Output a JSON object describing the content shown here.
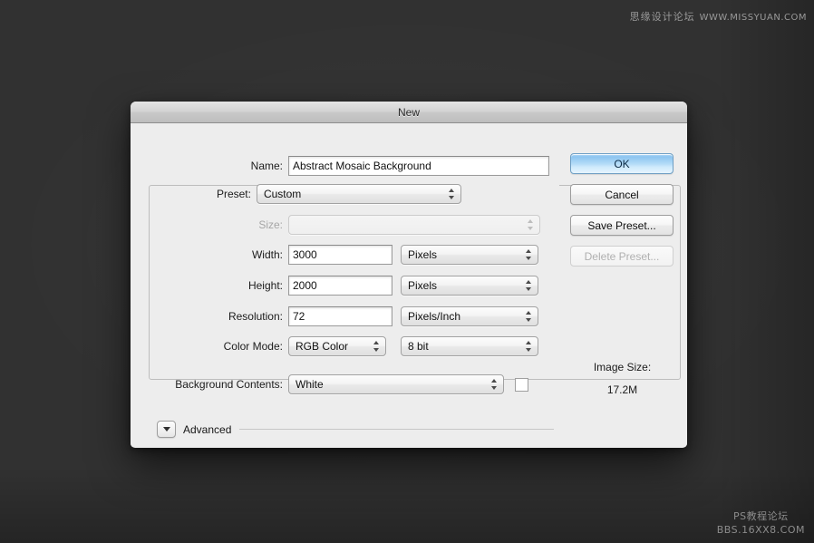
{
  "desktop": {
    "background_color": "#313131",
    "watermark_top": {
      "cn": "思缘设计论坛",
      "url": "WWW.MISSYUAN.COM"
    },
    "watermark_bottom": {
      "line1": "PS教程论坛",
      "line2": "BBS.16XX8.COM"
    }
  },
  "dialog": {
    "title": "New",
    "name_row": {
      "label": "Name:",
      "value": "Abstract Mosaic Background"
    },
    "preset_row": {
      "label": "Preset:",
      "value": "Custom"
    },
    "size_row": {
      "label": "Size:",
      "value": "",
      "disabled": true
    },
    "width_row": {
      "label": "Width:",
      "value": "3000",
      "unit": "Pixels"
    },
    "height_row": {
      "label": "Height:",
      "value": "2000",
      "unit": "Pixels"
    },
    "resolution_row": {
      "label": "Resolution:",
      "value": "72",
      "unit": "Pixels/Inch"
    },
    "color_mode_row": {
      "label": "Color Mode:",
      "value": "RGB Color",
      "depth": "8 bit"
    },
    "background_contents_row": {
      "label": "Background Contents:",
      "value": "White",
      "swatch_color": "#ffffff"
    },
    "advanced": {
      "label": "Advanced",
      "expanded": false
    },
    "buttons": {
      "ok": "OK",
      "cancel": "Cancel",
      "save_preset": "Save Preset...",
      "delete_preset": "Delete Preset...",
      "delete_preset_disabled": true
    },
    "image_size": {
      "label": "Image Size:",
      "value": "17.2M"
    },
    "accent_color": "#8cc5f0"
  }
}
